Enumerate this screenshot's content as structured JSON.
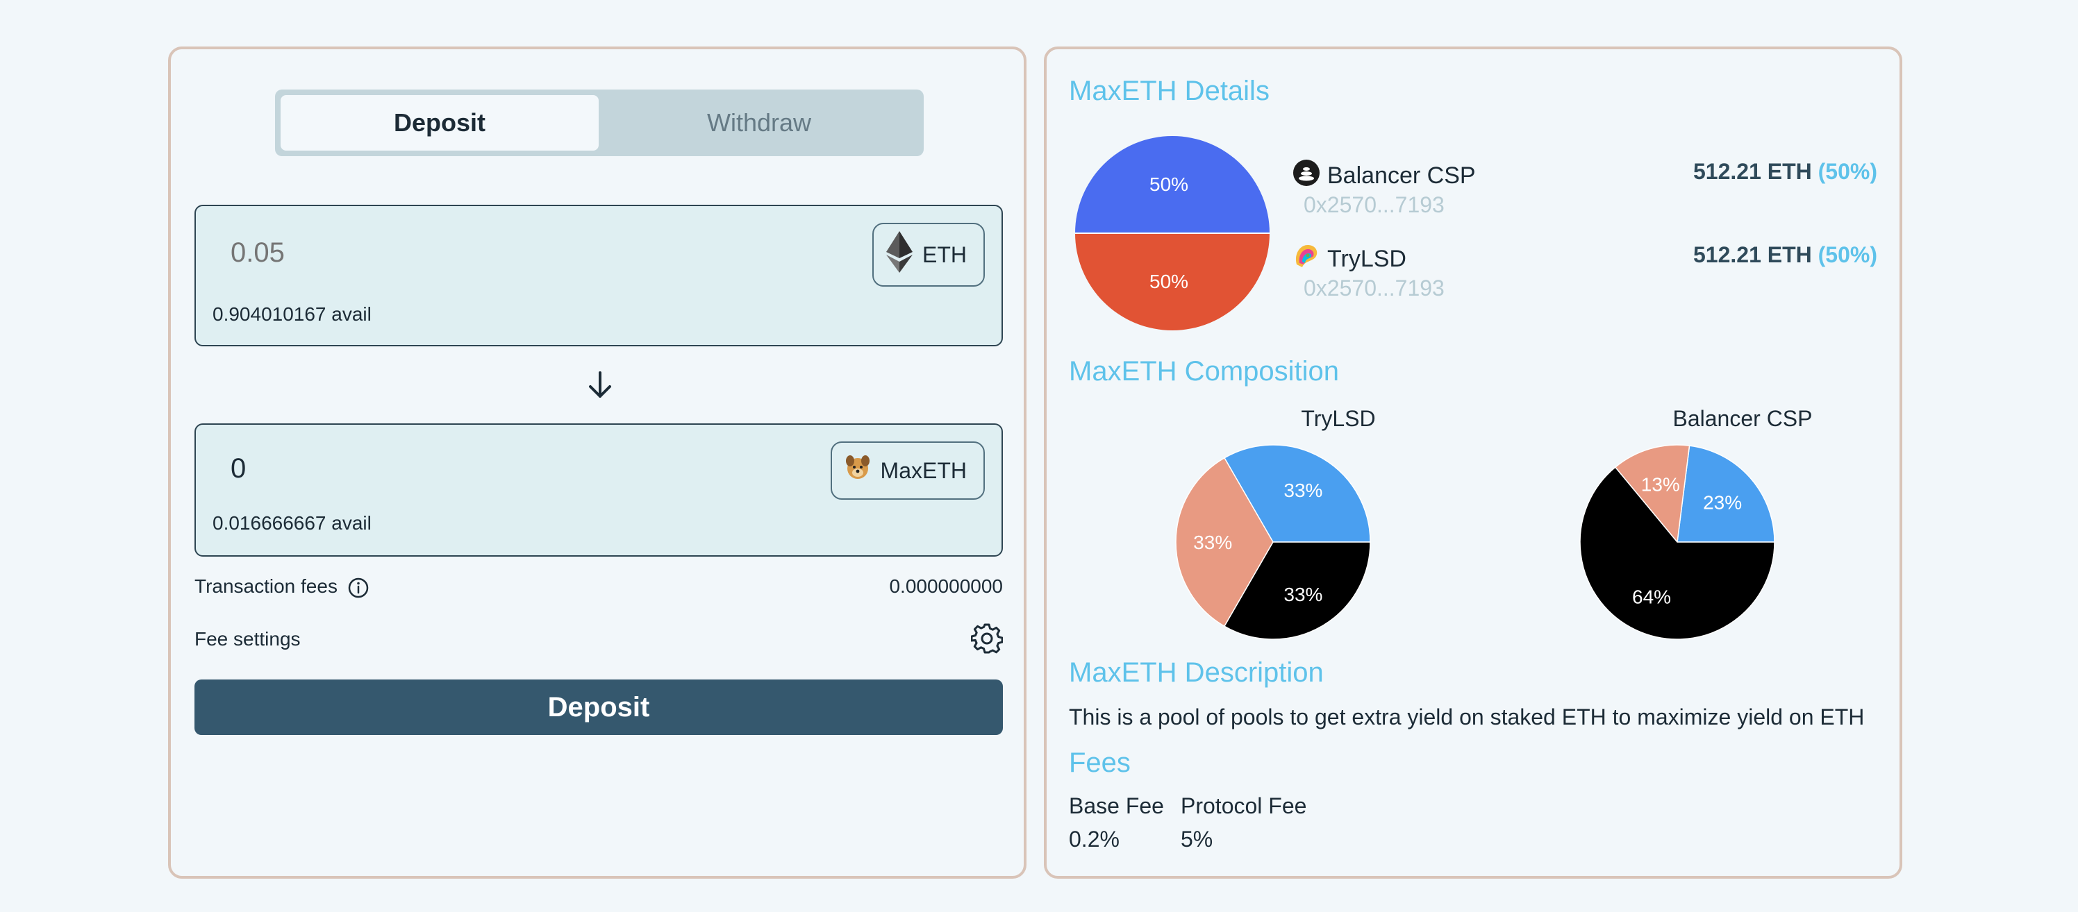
{
  "tabs": {
    "deposit": "Deposit",
    "withdraw": "Withdraw"
  },
  "from": {
    "placeholder": "0.05",
    "token": "ETH",
    "avail": "0.904010167 avail"
  },
  "to": {
    "value": "0",
    "token": "MaxETH",
    "avail": "0.016666667 avail"
  },
  "fees_info": {
    "transaction_fees_label": "Transaction fees",
    "transaction_fees_value": "0.000000000",
    "fee_settings_label": "Fee settings"
  },
  "deposit_button": "Deposit",
  "details": {
    "title": "MaxETH Details",
    "chart_label_top": "50%",
    "chart_label_bottom": "50%",
    "items": [
      {
        "name": "Balancer CSP",
        "address": "0x2570...7193",
        "amount": "512.21 ETH",
        "pct": "(50%)"
      },
      {
        "name": "TryLSD",
        "address": "0x2570...7193",
        "amount": "512.21 ETH",
        "pct": "(50%)"
      }
    ]
  },
  "composition": {
    "title": "MaxETH Composition",
    "trylsd": {
      "title": "TryLSD"
    },
    "balancer": {
      "title": "Balancer CSP"
    }
  },
  "description": {
    "title": "MaxETH Description",
    "text": "This is a pool of pools to get extra yield on staked ETH to maximize yield on ETH"
  },
  "fees": {
    "title": "Fees",
    "base_fee_label": "Base Fee",
    "base_fee_value": "0.2%",
    "protocol_fee_label": "Protocol Fee",
    "protocol_fee_value": "5%"
  },
  "chart_data": [
    {
      "type": "pie",
      "title": "",
      "categories": [
        "",
        ""
      ],
      "values": [
        50,
        50
      ],
      "labels": [
        "50%",
        "50%"
      ],
      "colors": [
        "#4a6cf0",
        "#e15334"
      ]
    },
    {
      "type": "pie",
      "title": "TryLSD",
      "categories": [
        "",
        "",
        ""
      ],
      "values": [
        33,
        33,
        33
      ],
      "labels": [
        "33%",
        "33%",
        "33%"
      ],
      "colors": [
        "#4a9ff0",
        "#000000",
        "#e89a82"
      ]
    },
    {
      "type": "pie",
      "title": "Balancer CSP",
      "categories": [
        "",
        "",
        ""
      ],
      "values": [
        23,
        64,
        13
      ],
      "labels": [
        "23%",
        "64%",
        "13%"
      ],
      "colors": [
        "#4a9ff0",
        "#000000",
        "#e89a82"
      ]
    }
  ]
}
